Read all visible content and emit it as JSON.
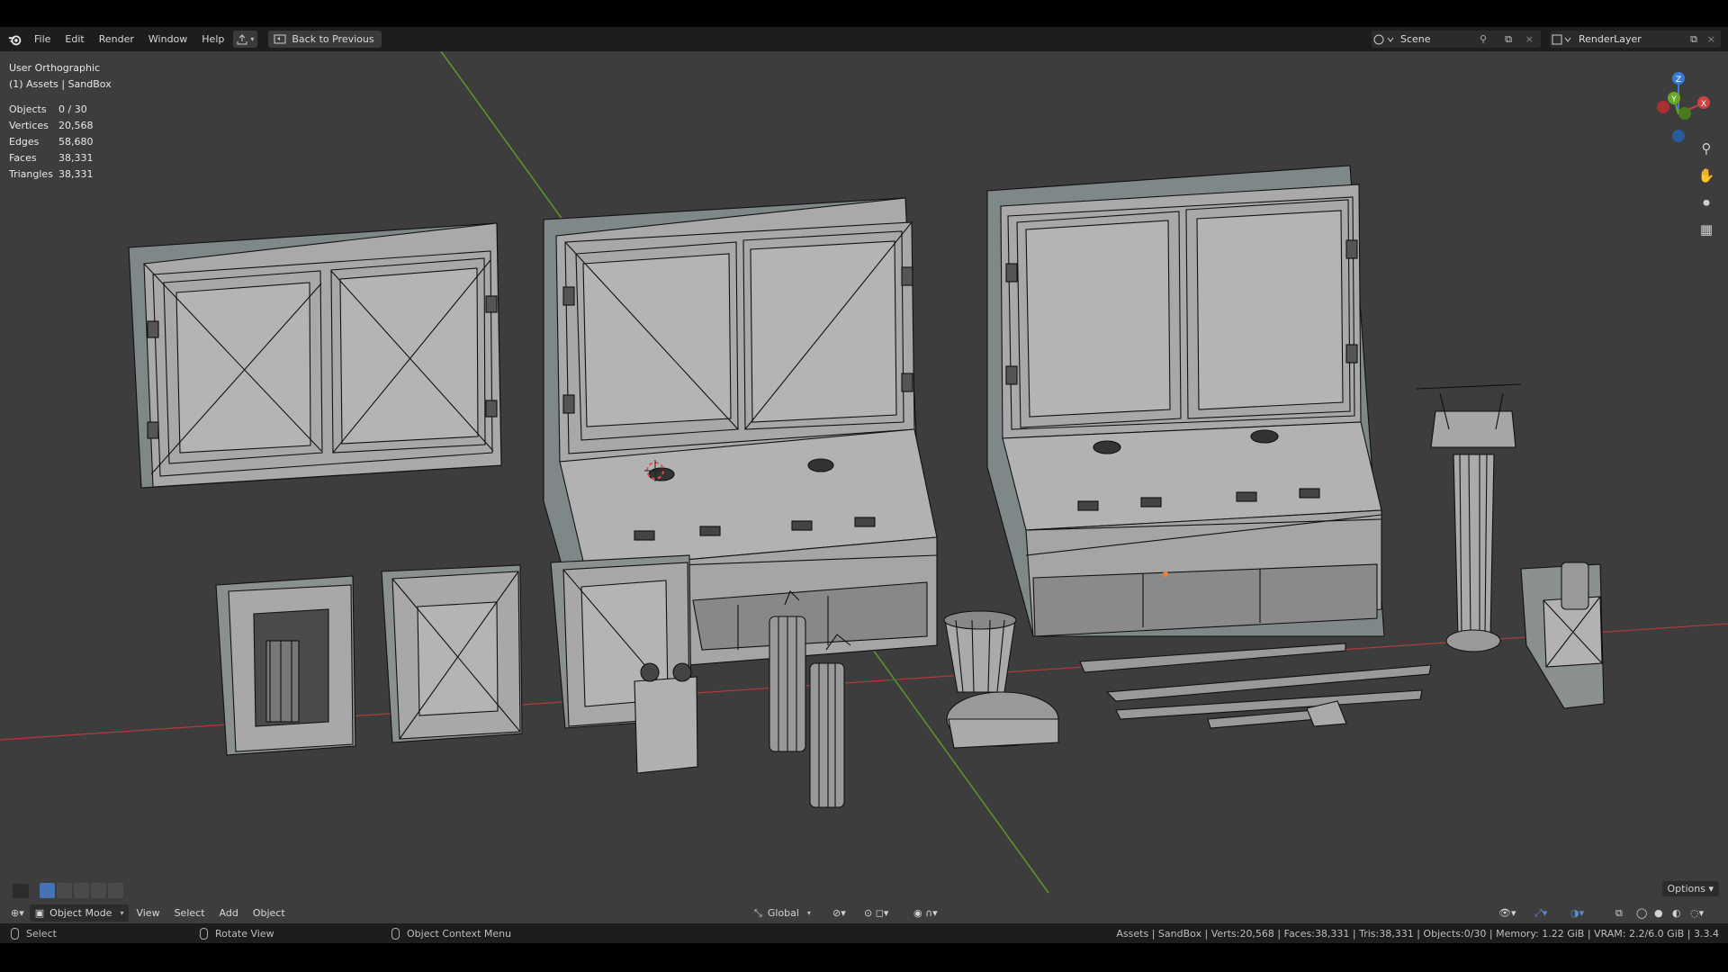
{
  "menu": {
    "file": "File",
    "edit": "Edit",
    "render": "Render",
    "window": "Window",
    "help": "Help",
    "back_button": "Back to Previous"
  },
  "scene": {
    "name": "Scene",
    "render_layer": "RenderLayer"
  },
  "viewport": {
    "view_name": "User Orthographic",
    "collection": "(1) Assets | SandBox",
    "stats": [
      {
        "label": "Objects",
        "value": "0 / 30"
      },
      {
        "label": "Vertices",
        "value": "20,568"
      },
      {
        "label": "Edges",
        "value": "58,680"
      },
      {
        "label": "Faces",
        "value": "38,331"
      },
      {
        "label": "Triangles",
        "value": "38,331"
      }
    ],
    "options_label": "Options",
    "axis_labels": {
      "z": "Z",
      "y": "Y",
      "x": "X"
    }
  },
  "header": {
    "mode": "Object Mode",
    "view": "View",
    "select": "Select",
    "add": "Add",
    "object": "Object",
    "orientation": "Global"
  },
  "statusbar": {
    "left_click": "Select",
    "middle_click": "Rotate View",
    "right_click": "Object Context Menu",
    "info": "Assets | SandBox | Verts:20,568 | Faces:38,331 | Tris:38,331 | Objects:0/30 | Memory: 1.22 GiB | VRAM: 2.2/6.0 GiB | 3.3.4"
  },
  "colors": {
    "viewport_bg": "#3d3d3d",
    "header_bg": "#1d1d1d",
    "x_axis": "#b53a3a",
    "y_axis": "#5a9a2a",
    "mesh_fill": "#a8a8a8",
    "mesh_wire": "#111111",
    "select_active": "#4772b3"
  }
}
